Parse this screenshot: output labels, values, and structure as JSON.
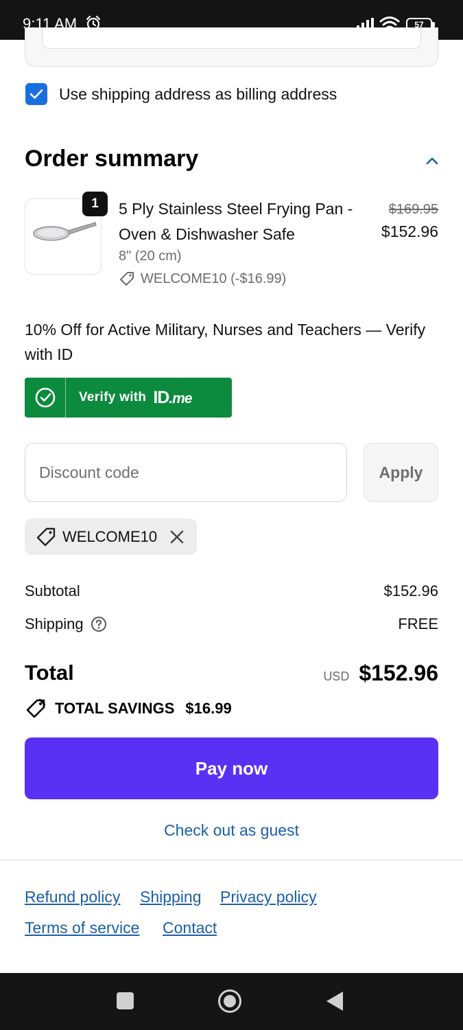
{
  "status_bar": {
    "time": "9:11 AM",
    "battery": "57"
  },
  "billing": {
    "checked": true,
    "label": "Use shipping address as billing address"
  },
  "order_summary": {
    "title": "Order summary",
    "item": {
      "quantity": "1",
      "title": "5 Ply Stainless Steel Frying Pan - Oven & Dishwasher Safe",
      "variant": "8\" (20 cm)",
      "discount": "WELCOME10 (-$16.99)",
      "price_original": "$169.95",
      "price_current": "$152.96"
    }
  },
  "promo": {
    "text": "10% Off for Active Military, Nurses and Teachers — Verify with ID",
    "idme_label": "Verify with",
    "idme_logo_id": "ID",
    "idme_logo_me": ".me"
  },
  "discount": {
    "placeholder": "Discount code",
    "apply_label": "Apply",
    "applied_code": "WELCOME10"
  },
  "totals": {
    "subtotal_label": "Subtotal",
    "subtotal_value": "$152.96",
    "shipping_label": "Shipping",
    "shipping_value": "FREE",
    "total_label": "Total",
    "currency": "USD",
    "total_value": "$152.96",
    "savings_label": "TOTAL SAVINGS",
    "savings_value": "$16.99"
  },
  "actions": {
    "pay_label": "Pay now",
    "guest_label": "Check out as guest"
  },
  "footer": {
    "refund": "Refund policy",
    "shipping": "Shipping",
    "privacy": "Privacy policy",
    "terms": "Terms of service",
    "contact": "Contact"
  },
  "colors": {
    "accent": "#5a31f4",
    "checkbox": "#1a6fe0",
    "idme": "#0c8a3e",
    "link": "#1a5ea8"
  },
  "icons": [
    "alarm-icon",
    "signal-icon",
    "wifi-icon",
    "battery-icon",
    "checkmark-icon",
    "chevron-up-icon",
    "tag-icon",
    "close-icon",
    "help-circle-icon",
    "savings-tag-icon",
    "nav-recents-icon",
    "nav-home-icon",
    "nav-back-icon"
  ]
}
